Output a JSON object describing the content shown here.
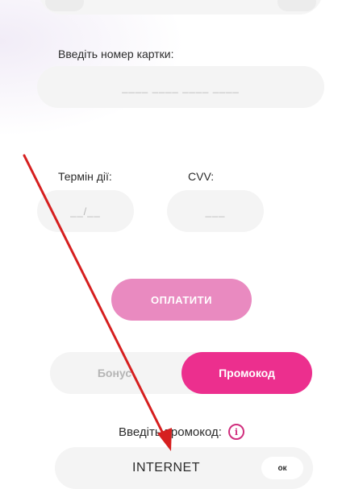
{
  "card": {
    "number_label": "Введіть номер картки:",
    "number_placeholder": "____  ____  ____  ____",
    "expiry_label": "Термін дії:",
    "expiry_placeholder": "__/__",
    "cvv_label": "CVV:",
    "cvv_placeholder": "___"
  },
  "pay_button_label": "ОПЛАТИТИ",
  "toggle": {
    "bonus_label": "Бонус",
    "promo_label": "Промокод",
    "selected": "Промокод"
  },
  "promo": {
    "label": "Введіть промокод:",
    "info_icon_glyph": "i",
    "value": "INTERNET",
    "ok_label": "ок"
  },
  "colors": {
    "accent": "#ec2f8e",
    "pay_button": "#e98ac0",
    "field_bg": "#f4f4f4",
    "annotation_arrow": "#d61f1f"
  },
  "icons": {
    "info": "info-icon",
    "annotation": "red-arrow-annotation"
  }
}
